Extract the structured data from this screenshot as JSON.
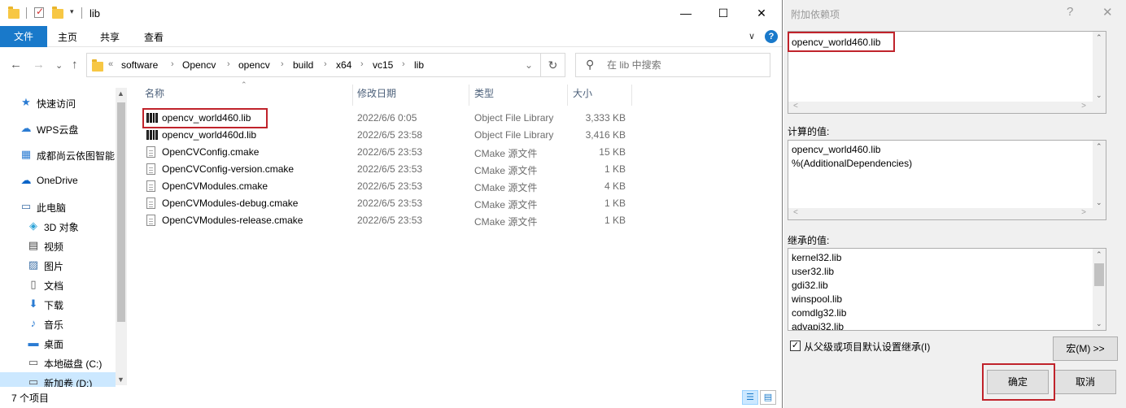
{
  "explorer": {
    "title": "lib",
    "window_buttons": {
      "minimize": "—",
      "maximize": "☐",
      "close": "✕"
    },
    "ribbon": {
      "tabs": [
        "文件",
        "主页",
        "共享",
        "查看"
      ],
      "collapse": "∨",
      "help": "?"
    },
    "nav": {
      "back": "←",
      "forward": "→",
      "recent": "⌄",
      "up": "↑"
    },
    "address": {
      "overflow": "«",
      "segments": [
        "software",
        "Opencv",
        "opencv",
        "build",
        "x64",
        "vc15",
        "lib"
      ],
      "separator": "›",
      "dropdown": "⌄",
      "refresh": "↻"
    },
    "search": {
      "placeholder": "在 lib 中搜索"
    },
    "nav_pane": [
      {
        "label": "快速访问",
        "icon": "star-icon",
        "glyph": "★",
        "color": "#2b7cd3"
      },
      {
        "label": "WPS云盘",
        "icon": "cloud-icon",
        "glyph": "☁",
        "color": "#2b7cd3"
      },
      {
        "label": "成都尚云依图智能",
        "icon": "building-icon",
        "glyph": "▦",
        "color": "#2b7cd3"
      },
      {
        "label": "OneDrive",
        "icon": "onedrive-icon",
        "glyph": "☁",
        "color": "#0a64c8"
      },
      {
        "label": "此电脑",
        "icon": "computer-icon",
        "glyph": "▭",
        "color": "#3b6ea5"
      },
      {
        "label": "3D 对象",
        "icon": "cube-icon",
        "glyph": "◈",
        "color": "#2fa4d8"
      },
      {
        "label": "视频",
        "icon": "video-icon",
        "glyph": "▤",
        "color": "#444444"
      },
      {
        "label": "图片",
        "icon": "picture-icon",
        "glyph": "▨",
        "color": "#3b6ea5"
      },
      {
        "label": "文档",
        "icon": "document-icon",
        "glyph": "▯",
        "color": "#555555"
      },
      {
        "label": "下载",
        "icon": "download-icon",
        "glyph": "⬇",
        "color": "#2b7cd3"
      },
      {
        "label": "音乐",
        "icon": "music-icon",
        "glyph": "♪",
        "color": "#2b7cd3"
      },
      {
        "label": "桌面",
        "icon": "desktop-icon",
        "glyph": "▬",
        "color": "#2b7cd3"
      },
      {
        "label": "本地磁盘 (C:)",
        "icon": "drive-icon",
        "glyph": "▭",
        "color": "#555555"
      },
      {
        "label": "新加卷 (D:)",
        "icon": "drive-icon",
        "glyph": "▭",
        "color": "#555555"
      }
    ],
    "columns": {
      "name": "名称",
      "date": "修改日期",
      "type": "类型",
      "size": "大小"
    },
    "files": [
      {
        "name": "opencv_world460.lib",
        "date": "2022/6/6 0:05",
        "type": "Object File Library",
        "size": "3,333 KB",
        "icon": "lib-file-icon"
      },
      {
        "name": "opencv_world460d.lib",
        "date": "2022/6/5 23:58",
        "type": "Object File Library",
        "size": "3,416 KB",
        "icon": "lib-file-icon"
      },
      {
        "name": "OpenCVConfig.cmake",
        "date": "2022/6/5 23:53",
        "type": "CMake 源文件",
        "size": "15 KB",
        "icon": "cmake-file-icon"
      },
      {
        "name": "OpenCVConfig-version.cmake",
        "date": "2022/6/5 23:53",
        "type": "CMake 源文件",
        "size": "1 KB",
        "icon": "cmake-file-icon"
      },
      {
        "name": "OpenCVModules.cmake",
        "date": "2022/6/5 23:53",
        "type": "CMake 源文件",
        "size": "4 KB",
        "icon": "cmake-file-icon"
      },
      {
        "name": "OpenCVModules-debug.cmake",
        "date": "2022/6/5 23:53",
        "type": "CMake 源文件",
        "size": "1 KB",
        "icon": "cmake-file-icon"
      },
      {
        "name": "OpenCVModules-release.cmake",
        "date": "2022/6/5 23:53",
        "type": "CMake 源文件",
        "size": "1 KB",
        "icon": "cmake-file-icon"
      }
    ],
    "status": "7 个项目",
    "views": {
      "details": "☰",
      "large": "▤"
    }
  },
  "dialog": {
    "title": "附加依赖项",
    "help": "?",
    "close": "✕",
    "input_value": "opencv_world460.lib",
    "computed_label": "计算的值:",
    "computed_text": "opencv_world460.lib\n%(AdditionalDependencies)",
    "inherited_label": "继承的值:",
    "inherited_text": "kernel32.lib\nuser32.lib\ngdi32.lib\nwinspool.lib\ncomdlg32.lib\nadvapi32.lib",
    "inherit_checkbox_label": "从父级或项目默认设置继承(I)",
    "inherit_checked": true,
    "check_glyph": "✓",
    "macro_button": "宏(M) >>",
    "ok_button": "确定",
    "cancel_button": "取消",
    "scroll_glyphs": {
      "left": "<",
      "right": ">",
      "up": "⌃",
      "down": "⌄"
    }
  },
  "colors": {
    "accent": "#1979ca",
    "highlight": "#c0232b",
    "selection": "#cce8ff"
  }
}
